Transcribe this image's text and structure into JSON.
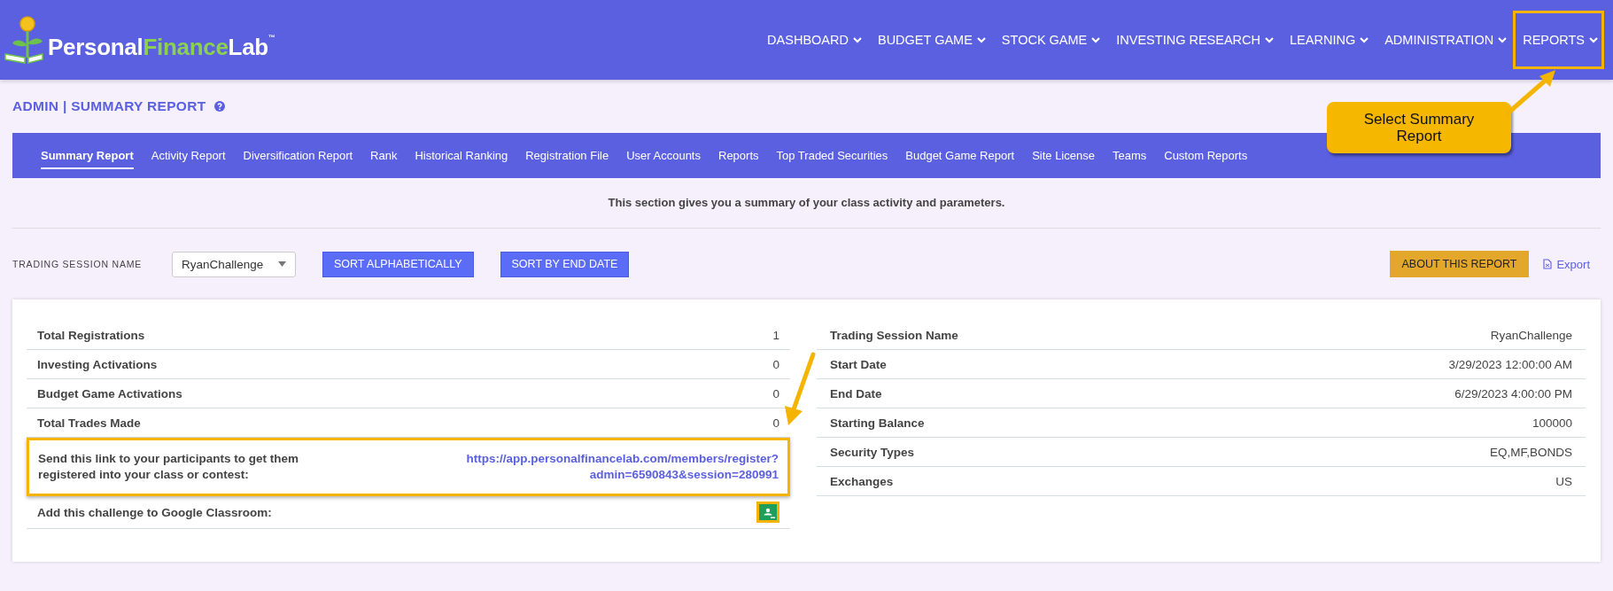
{
  "logo": {
    "parts": [
      "Personal",
      "Finance",
      "Lab"
    ],
    "trademark": "™"
  },
  "nav": [
    {
      "label": "DASHBOARD",
      "highlighted": false
    },
    {
      "label": "BUDGET GAME",
      "highlighted": false
    },
    {
      "label": "STOCK GAME",
      "highlighted": false
    },
    {
      "label": "INVESTING RESEARCH",
      "highlighted": false
    },
    {
      "label": "LEARNING",
      "highlighted": false
    },
    {
      "label": "ADMINISTRATION",
      "highlighted": false
    },
    {
      "label": "REPORTS",
      "highlighted": true
    }
  ],
  "page_title": "ADMIN | SUMMARY REPORT",
  "tabs": [
    {
      "label": "Summary Report",
      "selected": true
    },
    {
      "label": "Activity Report",
      "selected": false
    },
    {
      "label": "Diversification Report",
      "selected": false
    },
    {
      "label": "Rank",
      "selected": false
    },
    {
      "label": "Historical Ranking",
      "selected": false
    },
    {
      "label": "Registration File",
      "selected": false
    },
    {
      "label": "User Accounts",
      "selected": false
    },
    {
      "label": "Reports",
      "selected": false
    },
    {
      "label": "Top Traded Securities",
      "selected": false
    },
    {
      "label": "Budget Game Report",
      "selected": false
    },
    {
      "label": "Site License",
      "selected": false
    },
    {
      "label": "Teams",
      "selected": false
    },
    {
      "label": "Custom Reports",
      "selected": false
    }
  ],
  "description": "This section gives you a summary of your class activity and parameters.",
  "controls": {
    "session_label": "TRADING SESSION NAME",
    "session_value": "RyanChallenge",
    "sort_alpha": "SORT ALPHABETICALLY",
    "sort_end": "SORT BY END DATE",
    "about": "ABOUT THIS REPORT",
    "export": "Export"
  },
  "left_table": [
    {
      "kind": "text",
      "label": "Total Registrations",
      "value": "1",
      "highlighted": false
    },
    {
      "kind": "text",
      "label": "Investing Activations",
      "value": "0",
      "highlighted": false
    },
    {
      "kind": "text",
      "label": "Budget Game Activations",
      "value": "0",
      "highlighted": false
    },
    {
      "kind": "text",
      "label": "Total Trades Made",
      "value": "0",
      "highlighted": false
    },
    {
      "kind": "link",
      "label": "Send this link to your participants to get them registered into your class or contest:",
      "value": "https://app.personalfinancelab.com/members/register?admin=6590843&session=280991",
      "highlighted": true
    },
    {
      "kind": "classroom",
      "label": "Add this challenge to Google Classroom:",
      "highlighted": true
    }
  ],
  "right_table": [
    {
      "label": "Trading Session Name",
      "value": "RyanChallenge"
    },
    {
      "label": "Start Date",
      "value": "3/29/2023 12:00:00 AM"
    },
    {
      "label": "End Date",
      "value": "6/29/2023 4:00:00 PM"
    },
    {
      "label": "Starting Balance",
      "value": "100000"
    },
    {
      "label": "Security Types",
      "value": "EQ,MF,BONDS"
    },
    {
      "label": "Exchanges",
      "value": "US"
    }
  ],
  "callout": {
    "text": "Select Summary Report"
  }
}
